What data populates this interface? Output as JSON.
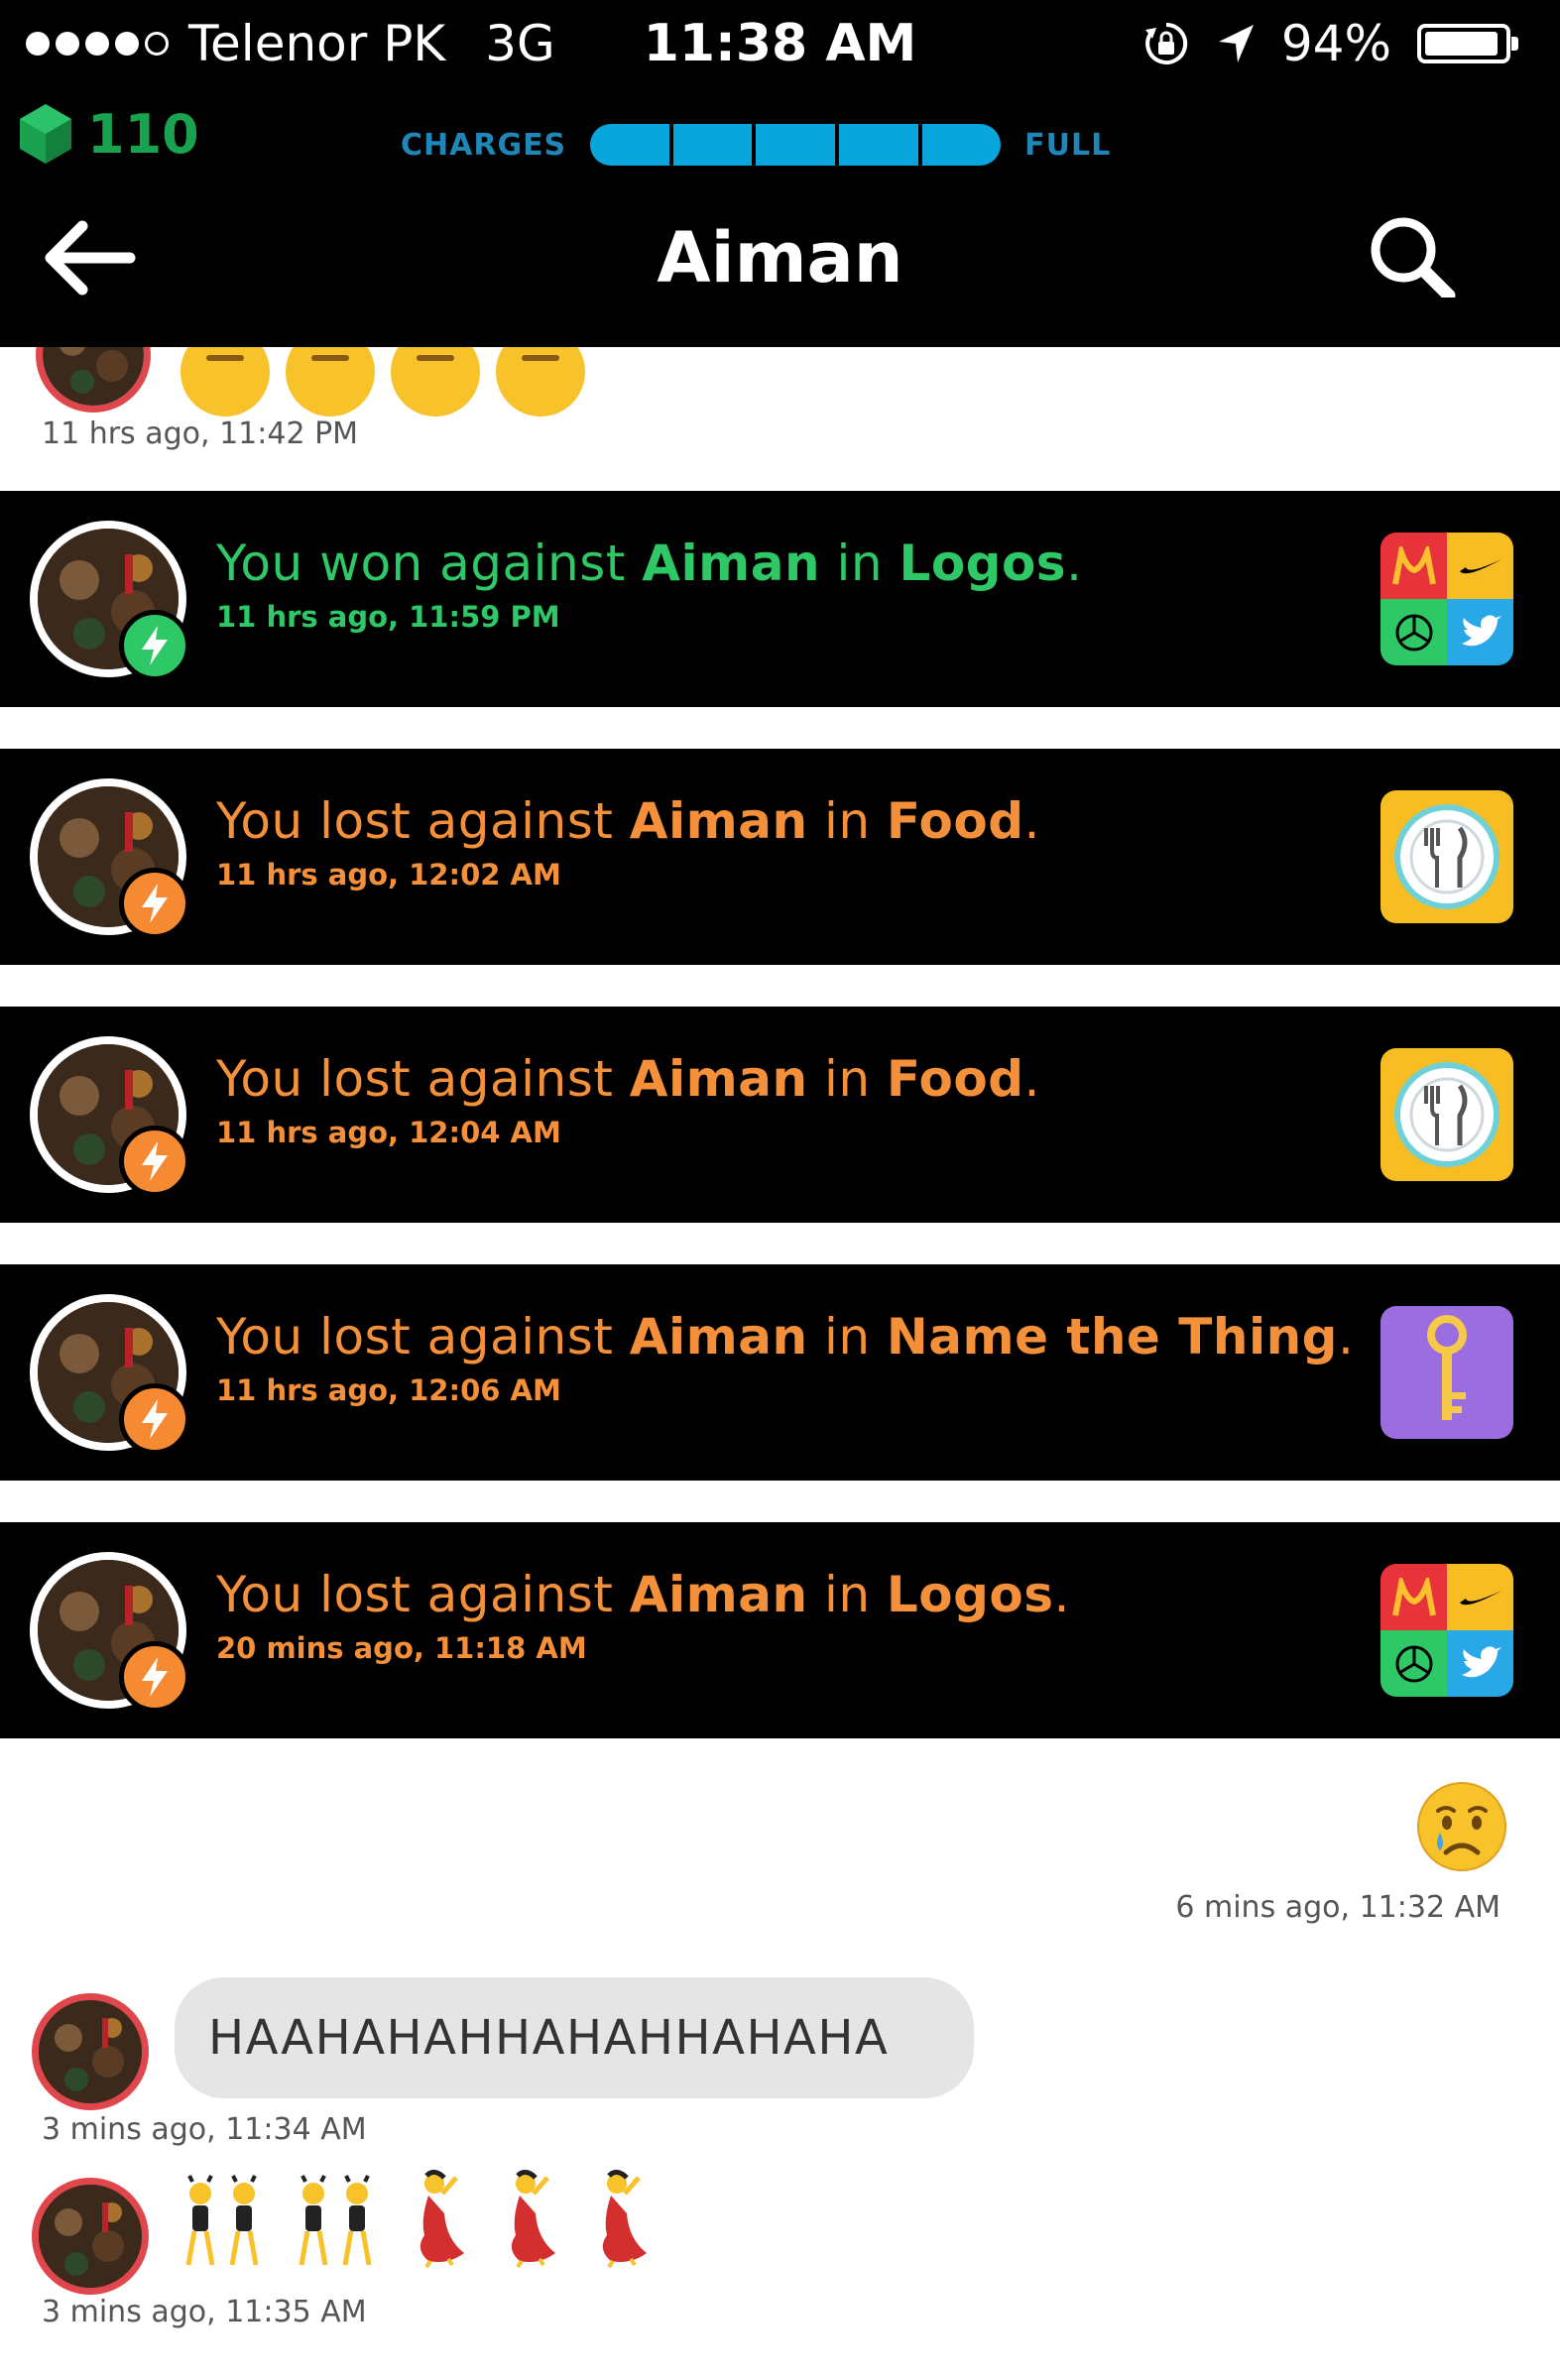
{
  "status_bar": {
    "carrier": "Telenor PK",
    "network": "3G",
    "time": "11:38 AM",
    "battery": "94%",
    "battery_level": 0.94,
    "signal_bars_filled": 4,
    "signal_bars_total": 5,
    "icons": [
      "orientation-lock-icon",
      "location-arrow-icon",
      "battery-icon"
    ]
  },
  "charges_bar": {
    "gems": "110",
    "charges_label": "CHARGES",
    "full_label": "FULL",
    "segments_filled": 5,
    "segments_total": 5,
    "accent_color": "#09a5dd",
    "gem_color": "#19a24f"
  },
  "nav": {
    "title": "Aiman",
    "back_icon": "back-arrow-icon",
    "search_icon": "search-icon"
  },
  "feed": {
    "top_message": {
      "timestamp": "11 hrs ago, 11:42 PM",
      "emoji": "neutral-face"
    },
    "game_results": [
      {
        "result": "win",
        "prefix": "You won against ",
        "opponent": "Aiman",
        "mid": " in ",
        "category": "Logos",
        "suffix": ".",
        "time": "11 hrs ago, 11:59 PM",
        "icon": "logos"
      },
      {
        "result": "loss",
        "prefix": "You lost against ",
        "opponent": "Aiman",
        "mid": " in ",
        "category": "Food",
        "suffix": ".",
        "time": "11 hrs ago, 12:02 AM",
        "icon": "food"
      },
      {
        "result": "loss",
        "prefix": "You lost against ",
        "opponent": "Aiman",
        "mid": " in ",
        "category": "Food",
        "suffix": ".",
        "time": "11 hrs ago, 12:04 AM",
        "icon": "food"
      },
      {
        "result": "loss",
        "prefix": "You lost against ",
        "opponent": "Aiman",
        "mid": " in ",
        "category": "Name the Thing",
        "suffix": ".",
        "time": "11 hrs ago, 12:06 AM",
        "icon": "name-the-thing"
      },
      {
        "result": "loss",
        "prefix": "You lost against ",
        "opponent": "Aiman",
        "mid": " in ",
        "category": "Logos",
        "suffix": ".",
        "time": "20 mins ago, 11:18 AM",
        "icon": "logos"
      }
    ],
    "my_emoji_message": {
      "emoji": "crying-face",
      "timestamp": "6 mins ago, 11:32 AM"
    },
    "their_text_message": {
      "text": "HAAHAHAHHAHAHHAHAHA",
      "timestamp": "3 mins ago, 11:34 AM"
    },
    "their_emoji_message": {
      "emojis": [
        "dancers",
        "dancers",
        "flamenco-dancer",
        "flamenco-dancer",
        "flamenco-dancer"
      ],
      "timestamp": "3 mins ago, 11:35 AM"
    },
    "colors": {
      "win": "#2ec866",
      "loss": "#f5903a",
      "avatar_ring": "#e0474c"
    }
  }
}
